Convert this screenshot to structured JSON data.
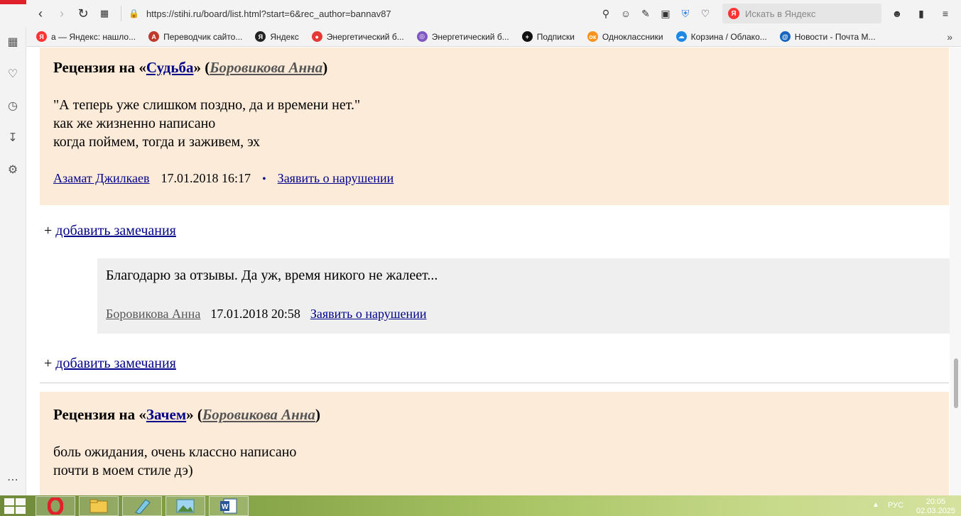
{
  "browser": {
    "url": "https://stihi.ru/board/list.html?start=6&rec_author=bannav87",
    "search_placeholder": "Искать в Яндекс",
    "search_badge": "Я",
    "bookmarks": [
      {
        "label": "а — Яндекс: нашло...",
        "icon": "yandex-icon",
        "color": "#f33",
        "glyph": "Я"
      },
      {
        "label": "Переводчик сайто...",
        "icon": "translator-icon",
        "color": "#c0392b",
        "glyph": "A"
      },
      {
        "label": "Яндекс",
        "icon": "yandex-icon",
        "color": "#222",
        "glyph": "Я"
      },
      {
        "label": "Энергетический б...",
        "icon": "location-pin-icon",
        "color": "#e53935",
        "glyph": "●"
      },
      {
        "label": "Энергетический б...",
        "icon": "globe-icon",
        "color": "#7e57c2",
        "glyph": "◎"
      },
      {
        "label": "Подписки",
        "icon": "plus-icon",
        "color": "#111",
        "glyph": "+"
      },
      {
        "label": "Одноклассники",
        "icon": "odnoklassniki-icon",
        "color": "#f7931e",
        "glyph": "ок"
      },
      {
        "label": "Корзина / Облако...",
        "icon": "cloud-icon",
        "color": "#1e88e5",
        "glyph": "☁"
      },
      {
        "label": "Новости - Почта М...",
        "icon": "mail-icon",
        "color": "#1565c0",
        "glyph": "@"
      }
    ],
    "bookmarks_more": "»"
  },
  "reviews": [
    {
      "title_prefix": "Рецензия на «",
      "poem": "Судьба",
      "title_mid": "» (",
      "author": "Боровикова Анна",
      "title_suffix": ")",
      "lines": [
        "\"А теперь уже слишком поздно, да и времени нет.\"",
        "как же жизненно написано",
        "когда поймем, тогда и заживем, эх"
      ],
      "reviewer": "Азамат Джилкаев",
      "date": "17.01.2018 16:17",
      "separator": "•",
      "report": "Заявить о нарушении"
    },
    {
      "title_prefix": "Рецензия на «",
      "poem": "Зачем",
      "title_mid": "» (",
      "author": "Боровикова Анна",
      "title_suffix": ")",
      "lines": [
        "боль ожидания, очень классно написано",
        "почти в моем стиле дэ)"
      ]
    }
  ],
  "add_remark": {
    "plus": "+ ",
    "label": "добавить замечания"
  },
  "reply": {
    "text": "Благодарю за отзывы. Да уж, время никого не жалеет...",
    "author": "Боровикова Анна",
    "date": "17.01.2018 20:58",
    "report": "Заявить о нарушении"
  },
  "taskbar": {
    "lang": "РУС",
    "time": "20:05",
    "date": "02.03.2025"
  }
}
